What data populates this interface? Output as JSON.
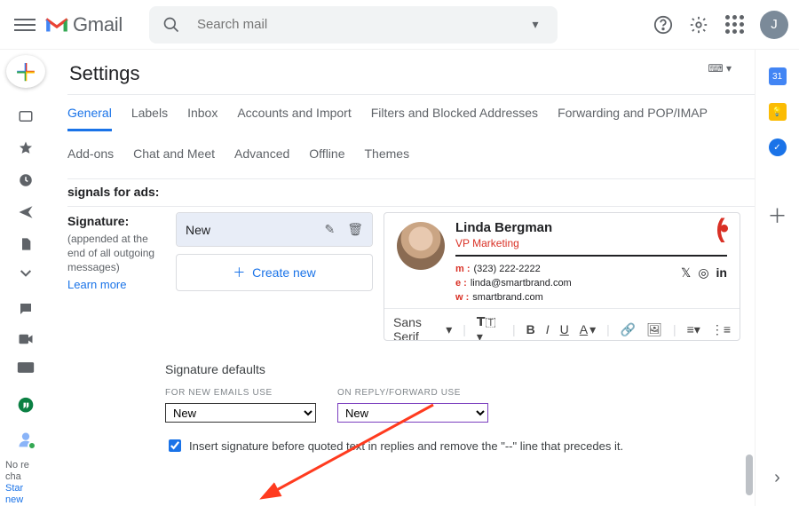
{
  "header": {
    "app_name": "Gmail",
    "search_placeholder": "Search mail",
    "avatar_initial": "J"
  },
  "leftnav": {
    "truncated_labels": "No re\ncha",
    "link1": "Star",
    "link2": "new"
  },
  "settings": {
    "title": "Settings",
    "tabs_row1": [
      "General",
      "Labels",
      "Inbox",
      "Accounts and Import",
      "Filters and Blocked Addresses",
      "Forwarding and POP/IMAP"
    ],
    "tabs_row2": [
      "Add-ons",
      "Chat and Meet",
      "Advanced",
      "Offline",
      "Themes"
    ],
    "prev_section_tail": "signals for ads:",
    "signature": {
      "label": "Signature:",
      "desc": "(appended at the end of all outgoing messages)",
      "learn_more": "Learn more",
      "items": [
        "New"
      ],
      "create_new": "Create new",
      "editor_font": "Sans Serif",
      "card": {
        "name": "Linda Bergman",
        "title": "VP Marketing",
        "phone_key": "m :",
        "phone": "(323) 222-2222",
        "email_key": "e :",
        "email": "linda@smartbrand.com",
        "web_key": "w :",
        "web": "smartbrand.com"
      }
    },
    "defaults": {
      "heading": "Signature defaults",
      "new_label": "FOR NEW EMAILS USE",
      "reply_label": "ON REPLY/FORWARD USE",
      "new_value": "New",
      "reply_value": "New",
      "checkbox_label": "Insert signature before quoted text in replies and remove the \"--\" line that precedes it."
    }
  }
}
